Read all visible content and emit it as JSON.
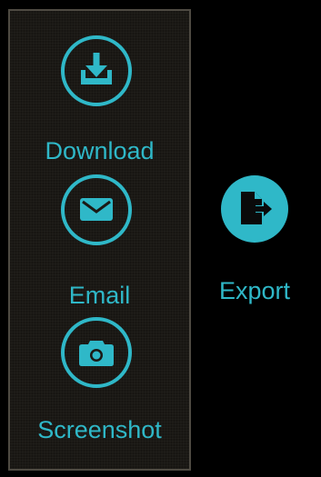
{
  "colors": {
    "accent": "#2fb8c8",
    "background": "#000000",
    "panel_background": "#1b1915",
    "panel_border": "#4e4a42"
  },
  "menu": {
    "items": [
      {
        "label": "Download",
        "icon": "download-icon"
      },
      {
        "label": "Email",
        "icon": "envelope-icon"
      },
      {
        "label": "Screenshot",
        "icon": "camera-icon"
      }
    ]
  },
  "export": {
    "label": "Export",
    "icon": "export-file-icon"
  }
}
